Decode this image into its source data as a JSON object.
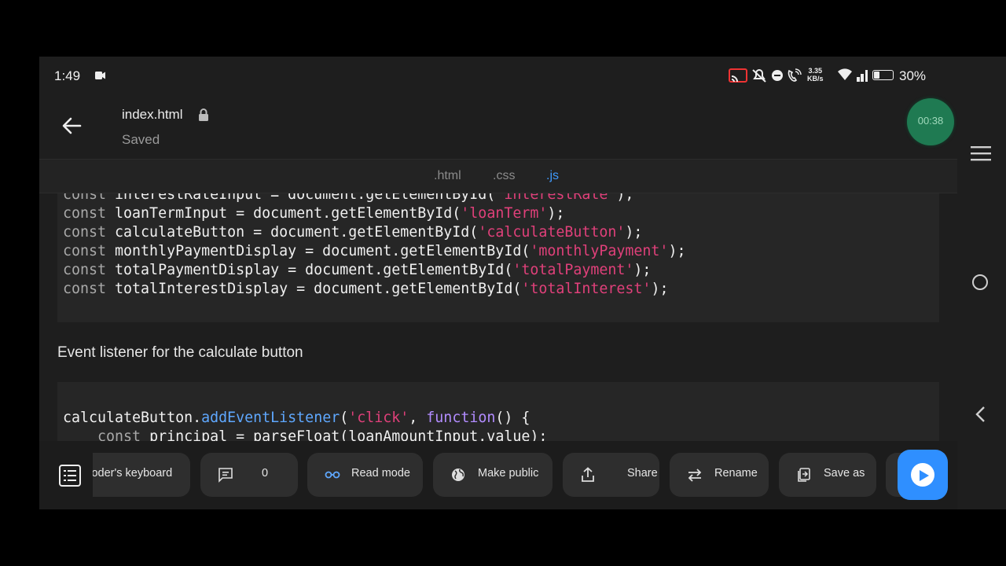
{
  "status_bar": {
    "time": "1:49",
    "speed_value": "3.35",
    "speed_unit": "KB/s",
    "battery": "30%",
    "battery_level": 0.3
  },
  "header": {
    "file_name": "index.html",
    "save_state": "Saved",
    "timer": "00:38"
  },
  "tabs": [
    {
      "label": ".html",
      "active": false
    },
    {
      "label": ".css",
      "active": false
    },
    {
      "label": ".js",
      "active": true
    }
  ],
  "code_block_1": [
    [
      {
        "t": "kw",
        "v": "const"
      },
      {
        "t": "p",
        "v": " interestRateInput = document.getElementById("
      },
      {
        "t": "str",
        "v": "'interestRate'"
      },
      {
        "t": "p",
        "v": ");"
      }
    ],
    [
      {
        "t": "kw",
        "v": "const"
      },
      {
        "t": "p",
        "v": " loanTermInput = document.getElementById("
      },
      {
        "t": "str",
        "v": "'loanTerm'"
      },
      {
        "t": "p",
        "v": ");"
      }
    ],
    [
      {
        "t": "kw",
        "v": "const"
      },
      {
        "t": "p",
        "v": " calculateButton = document.getElementById("
      },
      {
        "t": "str",
        "v": "'calculateButton'"
      },
      {
        "t": "p",
        "v": ");"
      }
    ],
    [
      {
        "t": "kw",
        "v": "const"
      },
      {
        "t": "p",
        "v": " monthlyPaymentDisplay = document.getElementById("
      },
      {
        "t": "str",
        "v": "'monthlyPayment'"
      },
      {
        "t": "p",
        "v": ");"
      }
    ],
    [
      {
        "t": "kw",
        "v": "const"
      },
      {
        "t": "p",
        "v": " totalPaymentDisplay = document.getElementById("
      },
      {
        "t": "str",
        "v": "'totalPayment'"
      },
      {
        "t": "p",
        "v": ");"
      }
    ],
    [
      {
        "t": "kw",
        "v": "const"
      },
      {
        "t": "p",
        "v": " totalInterestDisplay = document.getElementById("
      },
      {
        "t": "str",
        "v": "'totalInterest'"
      },
      {
        "t": "p",
        "v": ");"
      }
    ]
  ],
  "section_description": "Event listener for the calculate button",
  "code_block_2": [
    [
      {
        "t": "p",
        "v": "calculateButton."
      },
      {
        "t": "fn",
        "v": "addEventListener"
      },
      {
        "t": "p",
        "v": "("
      },
      {
        "t": "str",
        "v": "'click'"
      },
      {
        "t": "p",
        "v": ", "
      },
      {
        "t": "fnk",
        "v": "function"
      },
      {
        "t": "p",
        "v": "() {"
      }
    ],
    [
      {
        "t": "p",
        "v": "    "
      },
      {
        "t": "kw",
        "v": "const"
      },
      {
        "t": "p",
        "v": " principal = parseFloat(loanAmountInput.value);"
      }
    ]
  ],
  "toolbar": {
    "keyboard_label": "Coder's keyboard",
    "comments_count": "0",
    "read_mode_label": "Read mode",
    "make_public_label": "Make public",
    "share_label": "Share",
    "rename_label": "Rename",
    "save_as_label": "Save as"
  },
  "colors": {
    "accent": "#3f9bff",
    "run_button": "#2f8fff",
    "timer_bg": "#1f7a52",
    "string": "#e0407a"
  }
}
